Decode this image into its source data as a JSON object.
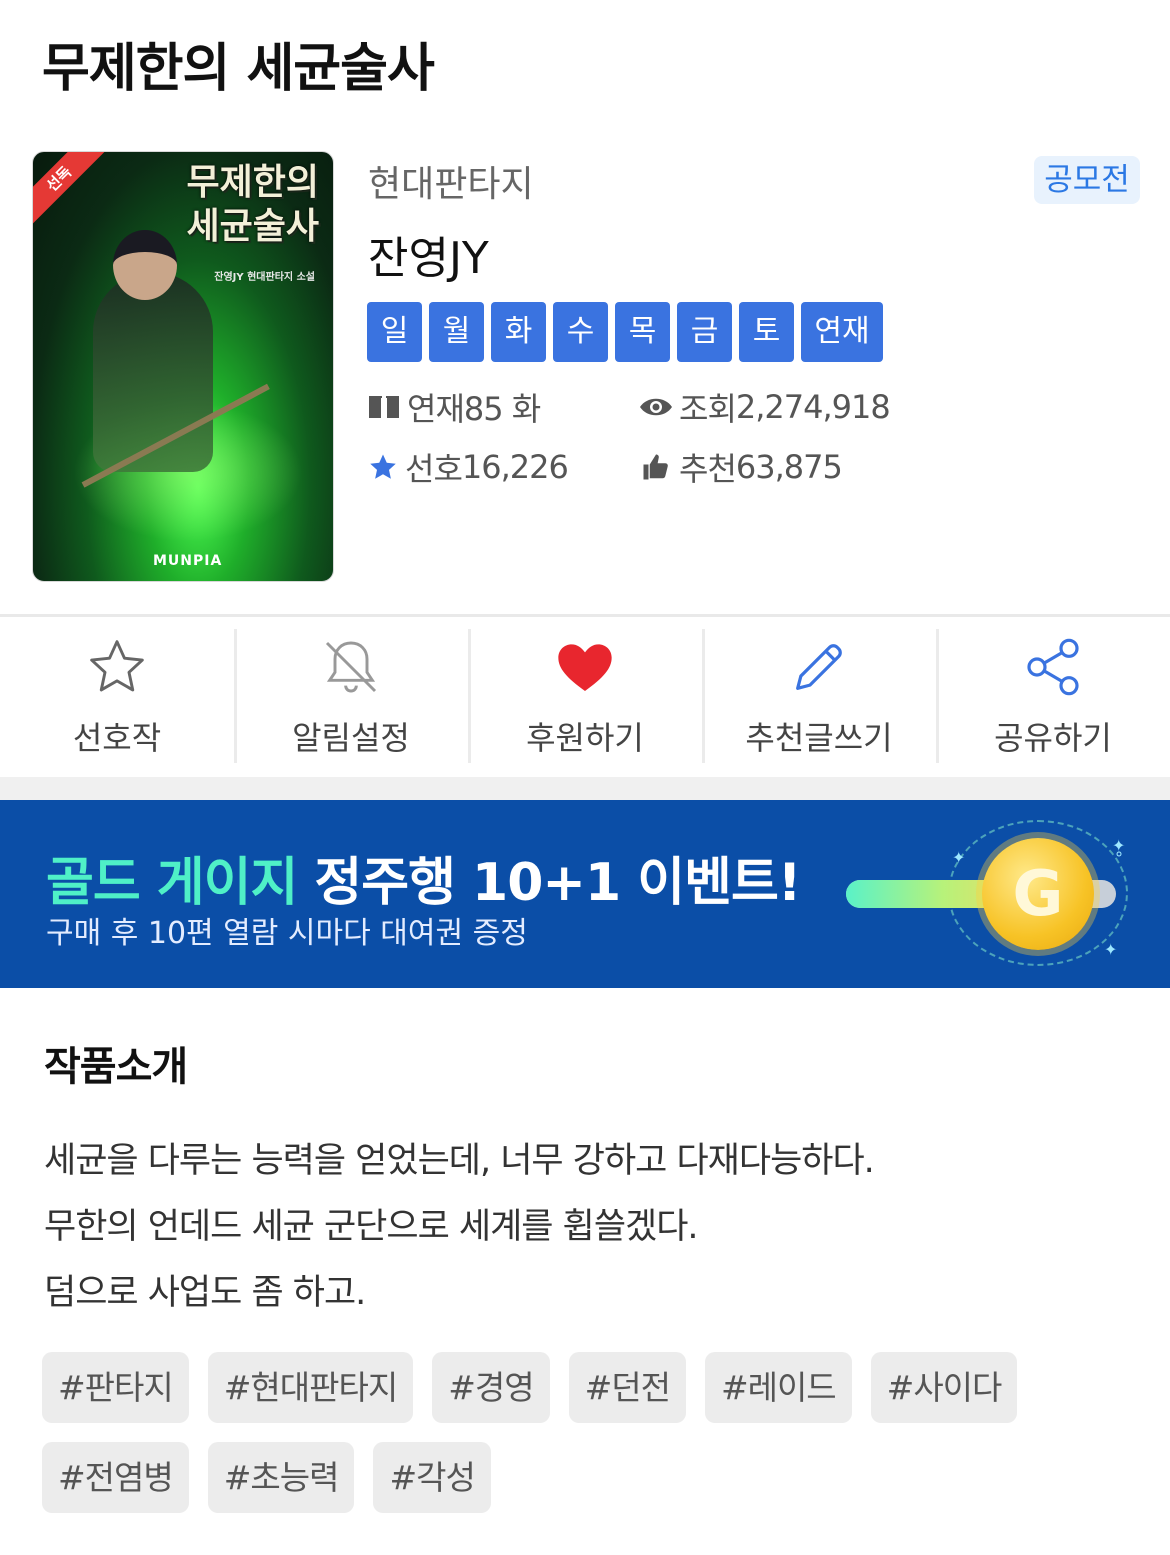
{
  "page": {
    "title": "무제한의 세균술사"
  },
  "cover": {
    "title_line1": "무제한의",
    "title_line2": "세균술사",
    "author_caption": "잔영JY 현대판타지 소설",
    "corner_badge": "선독",
    "publisher_logo": "MUNPIA"
  },
  "info": {
    "genre": "현대판타지",
    "contest_badge": "공모전",
    "author": "잔영JY",
    "days": [
      "일",
      "월",
      "화",
      "수",
      "목",
      "금",
      "토",
      "연재"
    ],
    "stats": {
      "episodes_label": "연재",
      "episodes_value": "85 화",
      "views_label": "조회",
      "views_value": "2,274,918",
      "favorites_label": "선호",
      "favorites_value": "16,226",
      "recommends_label": "추천",
      "recommends_value": "63,875"
    }
  },
  "actions": [
    {
      "label": "선호작",
      "icon": "star-outline-icon"
    },
    {
      "label": "알림설정",
      "icon": "bell-off-icon"
    },
    {
      "label": "후원하기",
      "icon": "heart-icon"
    },
    {
      "label": "추천글쓰기",
      "icon": "pencil-icon"
    },
    {
      "label": "공유하기",
      "icon": "share-icon"
    }
  ],
  "banner": {
    "headline_highlight": "골드 게이지",
    "headline_rest": " 정주행 10+1 이벤트!",
    "subtext": "구매 후 10편 열람 시마다 대여권 증정",
    "coin_letter": "G",
    "gauge_fill": 0.72
  },
  "intro": {
    "title": "작품소개",
    "lines": [
      "세균을 다루는 능력을 얻었는데, 너무 강하고 다재다능하다.",
      "무한의 언데드 세균 군단으로 세계를 휩쓸겠다.",
      "덤으로 사업도 좀 하고."
    ]
  },
  "tags": [
    "#판타지",
    "#현대판타지",
    "#경영",
    "#던전",
    "#레이드",
    "#사이다",
    "#전염병",
    "#초능력",
    "#각성"
  ],
  "colors": {
    "accent_blue": "#3a73e0",
    "badge_blue": "#2b78e4",
    "heart_red": "#e8262e",
    "banner_bg": "#0b4ea7",
    "banner_highlight": "#4ff0c7"
  }
}
